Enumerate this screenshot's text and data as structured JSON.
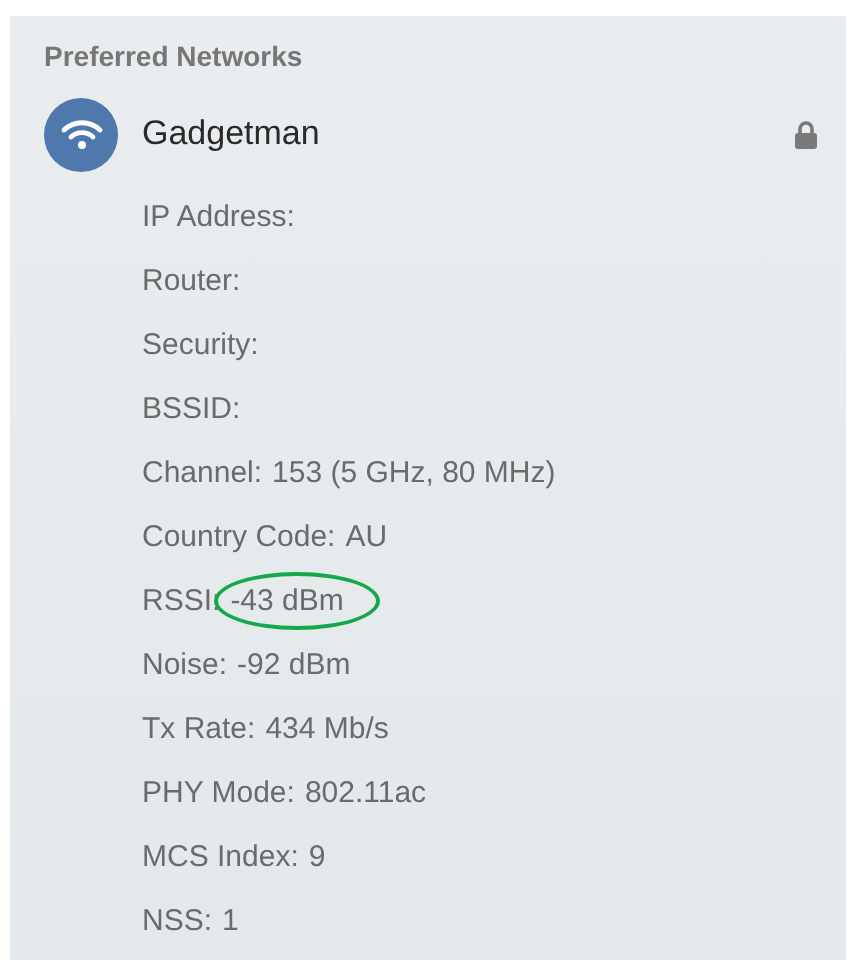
{
  "section_title": "Preferred Networks",
  "network": {
    "name": "Gadgetman",
    "locked": true
  },
  "details": [
    {
      "label": "IP Address:",
      "highlighted": false
    },
    {
      "label": "Router:",
      "highlighted": false
    },
    {
      "label": "Security:",
      "highlighted": false
    },
    {
      "label": "BSSID:",
      "highlighted": false
    },
    {
      "label": "Channel:",
      "value": "153 (5 GHz, 80 MHz)",
      "highlighted": false
    },
    {
      "label": "Country Code:",
      "value": "AU",
      "highlighted": false
    },
    {
      "label": "RSSI:",
      "value": "-43 dBm",
      "highlighted": true
    },
    {
      "label": "Noise:",
      "value": "-92 dBm",
      "highlighted": false
    },
    {
      "label": "Tx Rate:",
      "value": "434 Mb/s",
      "highlighted": false
    },
    {
      "label": "PHY Mode:",
      "value": "802.11ac",
      "highlighted": false
    },
    {
      "label": "MCS Index:",
      "value": "9",
      "highlighted": false
    },
    {
      "label": "NSS:",
      "value": "1",
      "highlighted": false
    }
  ]
}
